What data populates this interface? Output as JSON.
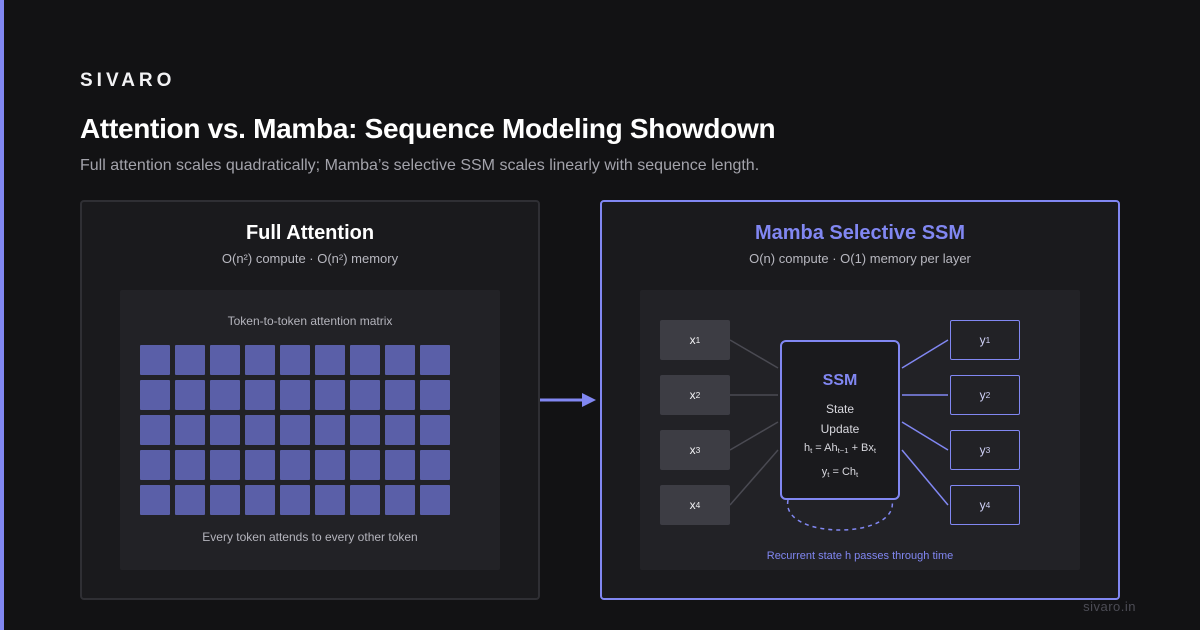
{
  "brand": "SIVARO",
  "title": "Attention vs. Mamba: Sequence Modeling Showdown",
  "subtitle": "Full attention scales quadratically; Mamba’s selective SSM scales linearly with sequence length.",
  "left_panel": {
    "title": "Full Attention",
    "complexity": "O(n²) compute · O(n²) memory",
    "matrix_label": "Token-to-token attention matrix",
    "matrix_caption": "Every token attends to every other token",
    "matrix_rows": 5,
    "matrix_cols": 9
  },
  "right_panel": {
    "title": "Mamba Selective SSM",
    "complexity": "O(n) compute · O(1) memory per layer",
    "inputs": [
      "x",
      "x",
      "x",
      "x"
    ],
    "input_subscripts": [
      "1",
      "2",
      "3",
      "4"
    ],
    "outputs": [
      "y",
      "y",
      "y",
      "y"
    ],
    "output_subscripts": [
      "1",
      "2",
      "3",
      "4"
    ],
    "ssm": {
      "title": "SSM",
      "state": "State",
      "update": "Update",
      "eq1_h": "h",
      "eq1_h_sub": "t",
      "eq1_mid": " = Ah",
      "eq1_mid_sub": "t−1",
      "eq1_end": " + Bx",
      "eq1_end_sub": "t",
      "eq2_y": "y",
      "eq2_y_sub": "t",
      "eq2_mid": " = Ch",
      "eq2_mid_sub": "t"
    },
    "recurrent_caption": "Recurrent state h passes through time"
  },
  "footer": "sivaro.in",
  "colors": {
    "background": "#121214",
    "accent": "#8187f2",
    "cell": "#5a5fa8",
    "panel": "#1a1a1d",
    "inner": "#222226"
  }
}
